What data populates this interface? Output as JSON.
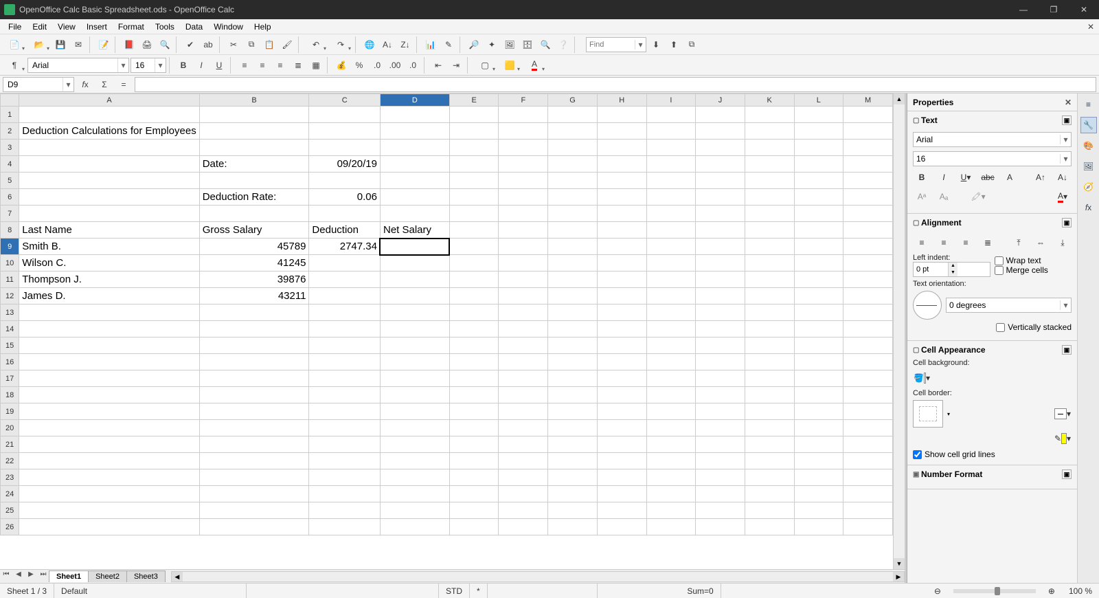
{
  "window": {
    "title": "OpenOffice Calc Basic Spreadsheet.ods - OpenOffice Calc"
  },
  "menu": {
    "file": "File",
    "edit": "Edit",
    "view": "View",
    "insert": "Insert",
    "format": "Format",
    "tools": "Tools",
    "data": "Data",
    "window": "Window",
    "help": "Help"
  },
  "find": {
    "placeholder": "Find"
  },
  "font": {
    "name": "Arial",
    "size": "16"
  },
  "cellref": {
    "value": "D9"
  },
  "formula": {
    "value": ""
  },
  "columns": [
    "A",
    "B",
    "C",
    "D",
    "E",
    "F",
    "G",
    "H",
    "I",
    "J",
    "K",
    "L",
    "M"
  ],
  "rows_count": 26,
  "selected": {
    "row": 9,
    "col": "D"
  },
  "cells": {
    "A2": "Deduction Calculations for Employees",
    "B4": "Date:",
    "C4": "09/20/19",
    "B6": "Deduction Rate:",
    "C6": "0.06",
    "A8": "Last Name",
    "B8": "Gross Salary",
    "C8": "Deduction",
    "D8": "Net Salary",
    "A9": "Smith B.",
    "B9": "45789",
    "C9": "2747.34",
    "A10": "Wilson C.",
    "B10": "41245",
    "A11": "Thompson J.",
    "B11": "39876",
    "A12": "James D.",
    "B12": "43211"
  },
  "numeric_cells": [
    "B9",
    "B10",
    "B11",
    "B12",
    "C4",
    "C6",
    "C9"
  ],
  "tabs": {
    "active": "Sheet1",
    "items": [
      "Sheet1",
      "Sheet2",
      "Sheet3"
    ]
  },
  "properties": {
    "title": "Properties",
    "text": {
      "title": "Text",
      "font": "Arial",
      "size": "16"
    },
    "alignment": {
      "title": "Alignment",
      "leftIndentLabel": "Left indent:",
      "leftIndent": "0 pt",
      "wrap": "Wrap text",
      "merge": "Merge cells",
      "orientationLabel": "Text orientation:",
      "orientation": "0 degrees",
      "vstack": "Vertically stacked"
    },
    "appearance": {
      "title": "Cell Appearance",
      "bgLabel": "Cell background:",
      "borderLabel": "Cell border:",
      "showGrid": "Show cell grid lines"
    },
    "number": {
      "title": "Number Format"
    }
  },
  "status": {
    "sheet": "Sheet 1 / 3",
    "style": "Default",
    "mode": "STD",
    "modified": "*",
    "sum": "Sum=0",
    "zoom": "100 %"
  }
}
